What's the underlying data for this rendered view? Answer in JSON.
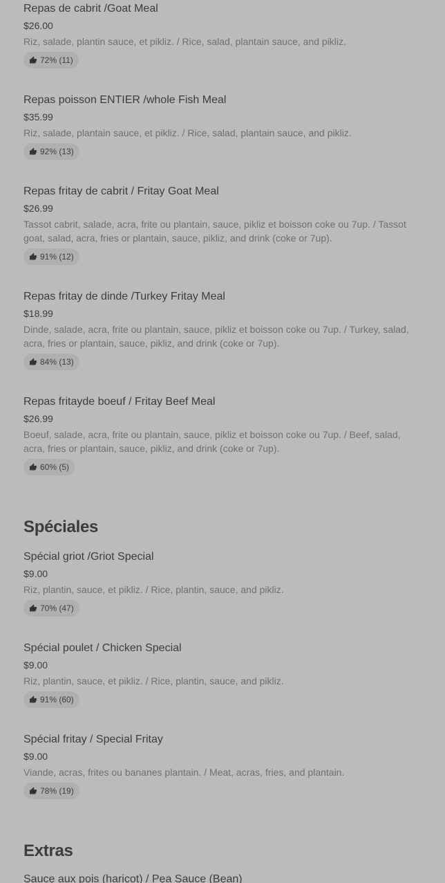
{
  "menu": {
    "items_top": [
      {
        "name": "Repas de cabrit /Goat Meal",
        "price": "$26.00",
        "description": "Riz, salade, plantin sauce, et pikliz. / Rice, salad, plantain sauce, and pikliz.",
        "rating": "72% (11)"
      },
      {
        "name": "Repas poisson ENTIER /whole Fish Meal",
        "price": "$35.99",
        "description": "Riz, salade, plantain sauce, et pikliz. / Rice, salad, plantain sauce, and pikliz.",
        "rating": "92% (13)"
      },
      {
        "name": "Repas fritay de cabrit / Fritay Goat Meal",
        "price": "$26.99",
        "description": "Tassot cabrit, salade, acra, frite ou plantain, sauce, pikliz et boisson coke ou 7up. / Tassot goat, salad, acra, fries or plantain, sauce, pikliz, and drink (coke or 7up).",
        "rating": "91% (12)"
      },
      {
        "name": "Repas fritay de dinde /Turkey Fritay Meal",
        "price": "$18.99",
        "description": "Dinde, salade, acra, frite ou plantain, sauce, pikliz et boisson coke ou 7up. / Turkey, salad, acra, fries or plantain, sauce, pikliz, and drink (coke or 7up).",
        "rating": "84% (13)"
      },
      {
        "name": "Repas fritayde boeuf / Fritay Beef Meal",
        "price": "$26.99",
        "description": "Boeuf, salade, acra, frite ou plantain, sauce, pikliz et boisson coke ou 7up. / Beef, salad, acra, fries or plantain, sauce, pikliz, and drink (coke or 7up).",
        "rating": "60% (5)"
      }
    ],
    "specials_title": "Spéciales",
    "specials": [
      {
        "name": "Spécial griot /Griot Special",
        "price": "$9.00",
        "description": "Riz, plantin, sauce, et pikliz. / Rice, plantin, sauce, and pikliz.",
        "rating": "70% (47)"
      },
      {
        "name": "Spécial poulet / Chicken Special",
        "price": "$9.00",
        "description": "Riz, plantin, sauce, et pikliz. / Rice, plantin, sauce, and pikliz.",
        "rating": "91% (60)"
      },
      {
        "name": "Spécial fritay / Special Fritay",
        "price": "$9.00",
        "description": "Viande, acras, frites ou bananes plantain. / Meat, acras, fries, and plantain.",
        "rating": "78% (19)"
      }
    ],
    "extras_title": "Extras",
    "extras": [
      {
        "name": "Sauce aux pois (haricot) / Pea Sauce (Bean)"
      }
    ]
  },
  "icons": {
    "rating_icon": "thumbs-up-icon"
  },
  "colors": {
    "background": "#bcbcbc",
    "rating_pill": "#b0b0b0",
    "text_primary": "#3b3b3b",
    "text_secondary": "#6d6d6d"
  }
}
